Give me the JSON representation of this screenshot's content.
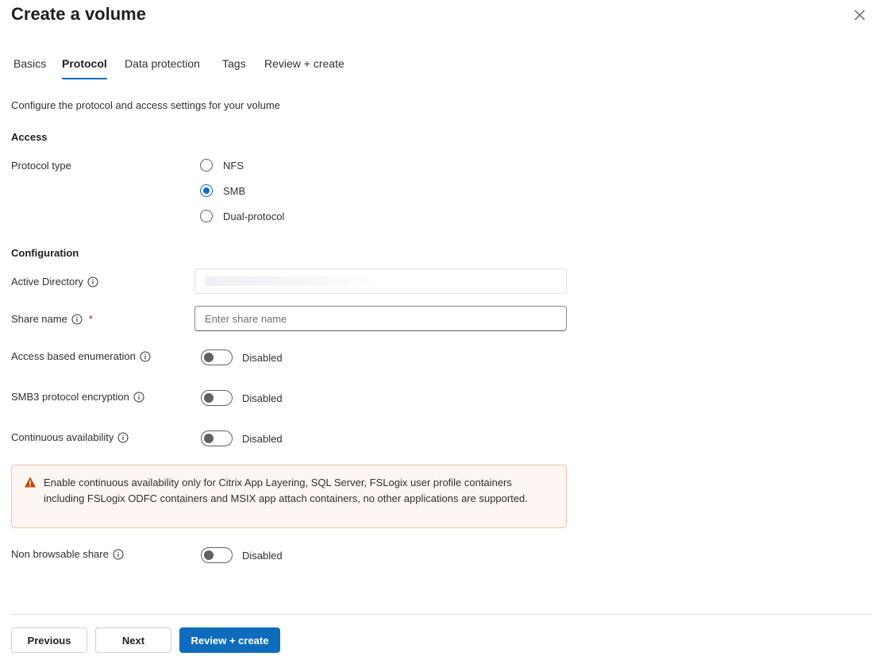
{
  "header": {
    "title": "Create a volume"
  },
  "tabs": [
    {
      "label": "Basics"
    },
    {
      "label": "Protocol"
    },
    {
      "label": "Data protection"
    },
    {
      "label": "Tags"
    },
    {
      "label": "Review + create"
    }
  ],
  "active_tab": "Protocol",
  "description": "Configure the protocol and access settings for your volume",
  "access": {
    "heading": "Access",
    "protocol_type_label": "Protocol type",
    "options": [
      {
        "label": "NFS",
        "selected": false
      },
      {
        "label": "SMB",
        "selected": true
      },
      {
        "label": "Dual-protocol",
        "selected": false
      }
    ]
  },
  "configuration": {
    "heading": "Configuration",
    "active_directory_label": "Active Directory",
    "share_name_label": "Share name",
    "share_name_required": "*",
    "share_name_placeholder": "Enter share name",
    "share_name_value": ""
  },
  "toggles": [
    {
      "label": "Access based enumeration",
      "state": "Disabled"
    },
    {
      "label": "SMB3 protocol encryption",
      "state": "Disabled"
    },
    {
      "label": "Continuous availability",
      "state": "Disabled"
    },
    {
      "label": "Non browsable share",
      "state": "Disabled"
    }
  ],
  "warning": {
    "text": "Enable continuous availability only for Citrix App Layering, SQL Server, FSLogix user profile containers including FSLogix ODFC containers and MSIX app attach containers, no other applications are supported.",
    "icon": "warning-icon"
  },
  "footer": {
    "previous_label": "Previous",
    "next_label": "Next",
    "review_label": "Review + create"
  },
  "colors": {
    "accent": "#0f6cbd",
    "warning_bg": "#fdf6f3",
    "warning_border": "#f4bfab",
    "warning_icon": "#bc4b09"
  }
}
